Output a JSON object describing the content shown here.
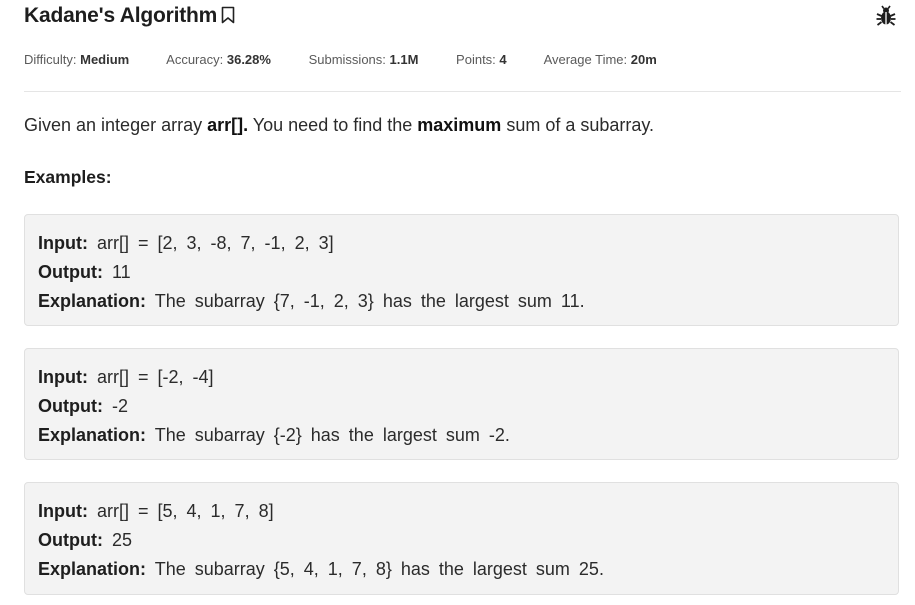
{
  "problem": {
    "title": "Kadane's Algorithm",
    "bookmark_icon": "bookmark-icon",
    "report_icon": "bug-icon"
  },
  "meta": {
    "difficulty_label": "Difficulty:",
    "difficulty_value": "Medium",
    "accuracy_label": "Accuracy:",
    "accuracy_value": "36.28%",
    "submissions_label": "Submissions:",
    "submissions_value": "1.1M",
    "points_label": "Points:",
    "points_value": "4",
    "time_label": "Average Time:",
    "time_value": "20m"
  },
  "statement": {
    "part1": "Given an integer array ",
    "bold1": "arr[].",
    "part2": " You need to find the ",
    "bold2": "maximum",
    "part3": " sum of a subarray."
  },
  "examples_heading": "Examples:",
  "labels": {
    "input": "Input:",
    "output": "Output:",
    "explanation": "Explanation:"
  },
  "examples": [
    {
      "input": "arr[] = [2, 3, -8, 7, -1, 2, 3]",
      "output": "11",
      "explanation": "The subarray {7, -1, 2, 3} has the largest sum 11."
    },
    {
      "input": "arr[] = [-2, -4]",
      "output": "-2",
      "explanation": "The subarray {-2} has the largest sum -2."
    },
    {
      "input": "arr[] = [5, 4, 1, 7, 8]",
      "output": "25",
      "explanation": "The subarray {5, 4, 1, 7, 8} has the largest sum 25."
    }
  ]
}
